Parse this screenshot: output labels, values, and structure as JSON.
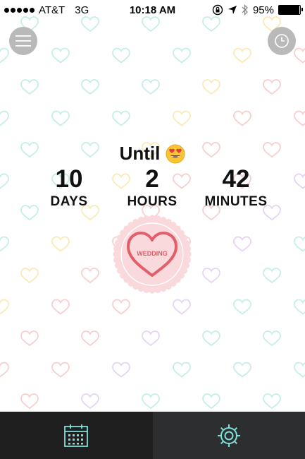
{
  "status_bar": {
    "carrier": "AT&T",
    "network": "3G",
    "time": "10:18 AM",
    "battery": "95%",
    "battery_level": 0.95
  },
  "main": {
    "until_text": "Until",
    "emoji": "heart-eyes-emoji",
    "countdown": [
      {
        "value": "10",
        "unit": "DAYS"
      },
      {
        "value": "2",
        "unit": "HOURS"
      },
      {
        "value": "42",
        "unit": "MINUTES"
      }
    ],
    "badge_label": "WEDDING"
  },
  "tab_bar": {
    "icons": [
      "calendar-icon",
      "gear-icon"
    ]
  },
  "colors": {
    "badge_heart": "#e25e69",
    "badge_fill": "#f9d9dc",
    "tab_icon": "#7fe0d8",
    "tab_left_bg": "#1f1f1f",
    "tab_right_bg": "#2c2e30"
  }
}
